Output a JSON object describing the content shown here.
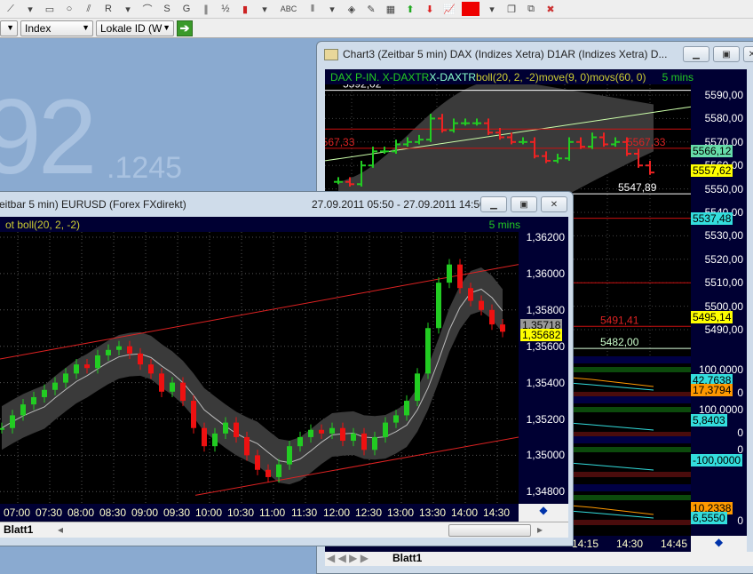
{
  "toolbar": {
    "icons": [
      "trendline-icon",
      "dropdown-icon",
      "rectangle-icon",
      "ellipse-icon",
      "fan-icon",
      "regression-icon",
      "dropdown-icon",
      "arc-icon",
      "speed-lines-icon",
      "gann-icon",
      "parallel-lines-icon",
      "fibonacci-icon",
      "color-bar-icon",
      "dropdown-icon",
      "text-icon",
      "vertical-lines-icon",
      "dropdown-icon",
      "crosshair-icon",
      "eraser-icon",
      "grid-icon",
      "arrow-up-icon",
      "arrow-down-icon",
      "indicator-icon",
      "color-swatch-icon",
      "dropdown-icon",
      "cascade-icon",
      "tile-icon",
      "close-all-icon"
    ],
    "text_label": "ABC",
    "color": "#ee0000"
  },
  "toolbar2": {
    "combo1": "",
    "combo2": "Index",
    "combo3": "Lokale ID (W"
  },
  "desktop": {
    "big": "92",
    "decimal": ".1245"
  },
  "chart3": {
    "title": "Chart3 (Zeitbar 5 min)  DAX (Indizes Xetra) D1AR (Indizes Xetra) D...",
    "legend_parts": [
      {
        "text": "DAX P-IN. X-DAXTR",
        "color": "#22cc22"
      },
      {
        "text": " X-DAXTR",
        "color": "#88ffcc"
      },
      {
        "text": " boll(20, 2, -2)",
        "color": "#cccc33"
      },
      {
        "text": " move(9, 0)",
        "color": "#cccc33"
      },
      {
        "text": " movs(60, 0)",
        "color": "#cccc33"
      }
    ],
    "interval": "5 mins",
    "price_ticks": [
      "5590,00",
      "5580,00",
      "5570,00",
      "5560,00",
      "5550,00",
      "5540,00",
      "5530,00",
      "5520,00",
      "5510,00",
      "5500,00",
      "5490,00"
    ],
    "tags": [
      {
        "text": "5566,12",
        "color": "#66ddaa",
        "value": 5566.12
      },
      {
        "text": "5557,62",
        "color": "#ffff00",
        "value": 5557.62
      },
      {
        "text": "5537,48",
        "color": "#33dddd",
        "value": 5537.48
      },
      {
        "text": "5495,14",
        "color": "#ffff00",
        "value": 5495.14
      }
    ],
    "labels": [
      {
        "text": "5592,02",
        "color": "#ffffff",
        "value": 5592.02
      },
      {
        "text": "5567,33",
        "color": "#dd2222",
        "value": 5567.33
      },
      {
        "text": "5567,33",
        "color": "#dd2222",
        "value": 5567.33
      },
      {
        "text": "5547,89",
        "color": "#ffffff",
        "value": 5547.89
      },
      {
        "text": "5491,41",
        "color": "#dd2222",
        "value": 5491.41
      },
      {
        "text": "5482,00",
        "color": "#ccffcc",
        "value": 5482.0
      }
    ],
    "sub_panels": [
      {
        "top": "100,0000",
        "bottom": "0",
        "tags": [
          {
            "text": "42,7638",
            "color": "#33dddd"
          },
          {
            "text": "17,3794",
            "color": "#ff9900"
          }
        ]
      },
      {
        "top": "100,0000",
        "bottom": "0",
        "tags": [
          {
            "text": "5,8403",
            "color": "#33dddd"
          }
        ]
      },
      {
        "top": "0",
        "bottom": "",
        "tags": [
          {
            "text": "-100,0000",
            "color": "#33dddd"
          }
        ]
      },
      {
        "top": "",
        "bottom": "0",
        "tags": [
          {
            "text": "10,2338",
            "color": "#ff9900"
          },
          {
            "text": "6,5550",
            "color": "#33dddd"
          }
        ]
      }
    ],
    "time_ticks": [
      "14:15",
      "14:30",
      "14:45"
    ],
    "sheet_tab": "Blatt1"
  },
  "eurusd": {
    "title": "eitbar 5 min)  EURUSD (Forex FXdirekt)",
    "range": "27.09.2011 05:50 - 27.09.2011 14:50",
    "legend": "ot boll(20, 2, -2)",
    "interval": "5 mins",
    "price_ticks": [
      "1,36200",
      "1,36000",
      "1,35800",
      "1,35600",
      "1,35400",
      "1,35200",
      "1,35000",
      "1,34800"
    ],
    "tags": [
      {
        "text": "1,35718",
        "color": "#999999",
        "value": 1.35718
      },
      {
        "text": "1,35682",
        "color": "#ffff00",
        "value": 1.35682
      }
    ],
    "time_ticks": [
      "07:00",
      "07:30",
      "08:00",
      "08:30",
      "09:00",
      "09:30",
      "10:00",
      "10:30",
      "11:00",
      "11:30",
      "12:00",
      "12:30",
      "13:00",
      "13:30",
      "14:00",
      "14:30"
    ],
    "sheet_tab": "Blatt1"
  },
  "chart_data": [
    {
      "type": "candlestick",
      "title": "EURUSD 5 min",
      "ylim": [
        1.348,
        1.362
      ],
      "x_start": "06:45",
      "step_minutes": 10,
      "closes": [
        1.3515,
        1.3522,
        1.3528,
        1.3532,
        1.3536,
        1.354,
        1.3545,
        1.355,
        1.3548,
        1.3555,
        1.3558,
        1.356,
        1.3556,
        1.355,
        1.3545,
        1.3535,
        1.354,
        1.353,
        1.3515,
        1.3505,
        1.3512,
        1.3518,
        1.351,
        1.35,
        1.3492,
        1.3488,
        1.3495,
        1.3505,
        1.351,
        1.3514,
        1.3512,
        1.3515,
        1.3508,
        1.3512,
        1.3503,
        1.351,
        1.3518,
        1.3522,
        1.353,
        1.3545,
        1.357,
        1.3595,
        1.3605,
        1.3592,
        1.3585,
        1.358,
        1.3572,
        1.3568
      ]
    },
    {
      "type": "ohlc-step",
      "title": "DAX 5 min",
      "ylim": [
        5480,
        5595
      ],
      "closes": [
        5553,
        5552,
        5560,
        5566,
        5566,
        5569,
        5570,
        5571,
        5580,
        5575,
        5578,
        5578,
        5578,
        5574,
        5572,
        5570,
        5570,
        5564,
        5562,
        5563,
        5570,
        5568,
        5572,
        5569,
        5570,
        5565,
        5560,
        5557
      ]
    }
  ]
}
